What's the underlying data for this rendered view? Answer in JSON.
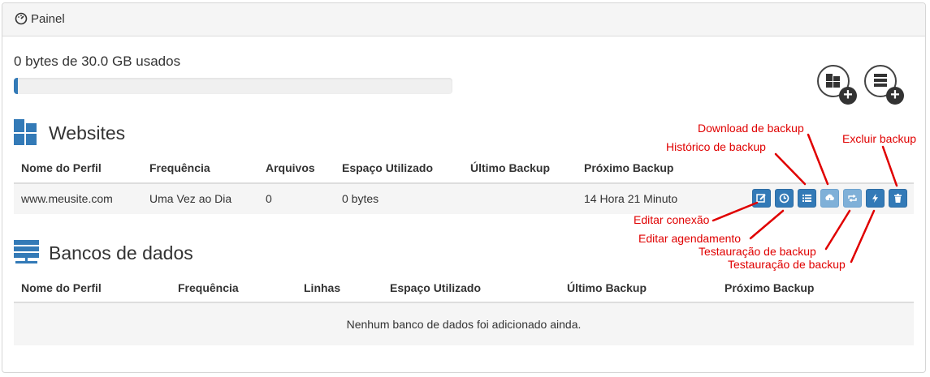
{
  "panel": {
    "title": "Painel"
  },
  "usage": {
    "text": "0 bytes de 30.0 GB usados",
    "progress_fraction": 0.01
  },
  "quick_add": {
    "buttons": [
      {
        "icon": "add-website-icon"
      },
      {
        "icon": "add-database-icon"
      }
    ]
  },
  "websites": {
    "title": "Websites",
    "columns": [
      "Nome do Perfil",
      "Frequência",
      "Arquivos",
      "Espaço Utilizado",
      "Último Backup",
      "Próximo Backup"
    ],
    "rows": [
      {
        "name": "www.meusite.com",
        "frequency": "Uma Vez ao Dia",
        "files": "0",
        "space": "0 bytes",
        "last": "",
        "next": "14 Hora 21 Minuto"
      }
    ]
  },
  "databases": {
    "title": "Bancos de dados",
    "columns": [
      "Nome do Perfil",
      "Frequência",
      "Linhas",
      "Espaço Utilizado",
      "Último Backup",
      "Próximo Backup"
    ],
    "empty_message": "Nenhum banco de dados foi adicionado ainda."
  },
  "annotations": {
    "download": "Download de backup",
    "historico": "Histórico de backup",
    "excluir": "Excluir backup",
    "editar_conexao": "Editar conexão",
    "editar_agendamento": "Editar agendamento",
    "restauracao_1": "Testauração de backup",
    "restauracao_2": "Testauração de backup"
  },
  "colors": {
    "primary": "#337ab7",
    "annotation": "#e00000"
  }
}
